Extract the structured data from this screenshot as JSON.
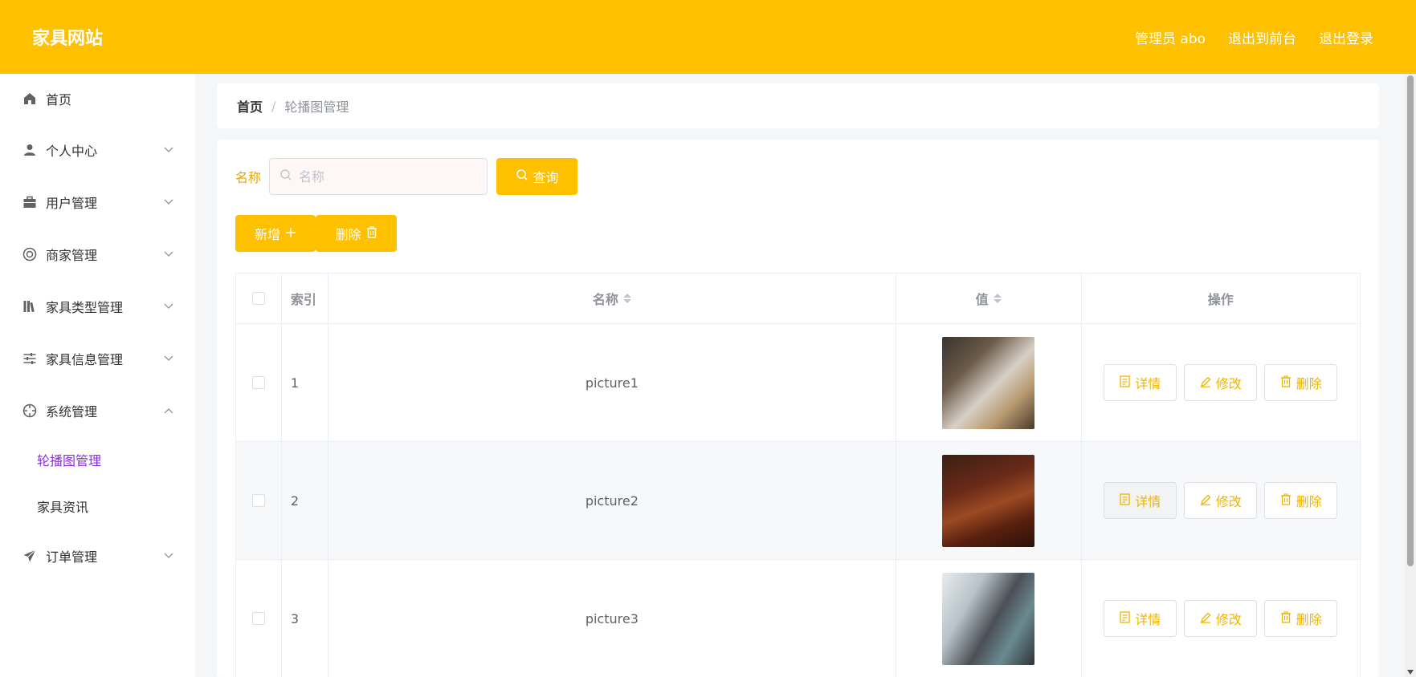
{
  "header": {
    "brand": "家具网站",
    "links": [
      "管理员 abo",
      "退出到前台",
      "退出登录"
    ]
  },
  "sidebar": {
    "items": [
      {
        "label": "首页",
        "icon": "home-icon"
      },
      {
        "label": "个人中心",
        "icon": "user-icon"
      },
      {
        "label": "用户管理",
        "icon": "briefcase-icon"
      },
      {
        "label": "商家管理",
        "icon": "lifebuoy-icon"
      },
      {
        "label": "家具类型管理",
        "icon": "books-icon"
      },
      {
        "label": "家具信息管理",
        "icon": "sliders-icon"
      },
      {
        "label": "系统管理",
        "icon": "crosshair-icon"
      },
      {
        "label": "订单管理",
        "icon": "send-icon"
      }
    ],
    "sub_items": [
      {
        "label": "轮播图管理",
        "active": true
      },
      {
        "label": "家具资讯",
        "active": false
      }
    ]
  },
  "breadcrumb": {
    "home": "首页",
    "separator": "/",
    "current": "轮播图管理"
  },
  "search": {
    "label": "名称",
    "placeholder": "名称",
    "query_label": "查询"
  },
  "actions": {
    "add_label": "新增",
    "delete_label": "删除"
  },
  "table": {
    "headers": {
      "index": "索引",
      "name": "名称",
      "value": "值",
      "ops": "操作"
    },
    "rows": [
      {
        "index": "1",
        "name": "picture1"
      },
      {
        "index": "2",
        "name": "picture2"
      },
      {
        "index": "3",
        "name": "picture3"
      }
    ],
    "op_labels": {
      "detail": "详情",
      "edit": "修改",
      "delete": "删除"
    }
  },
  "colors": {
    "primary": "#ffc000",
    "active_sub": "#8a2be2"
  }
}
